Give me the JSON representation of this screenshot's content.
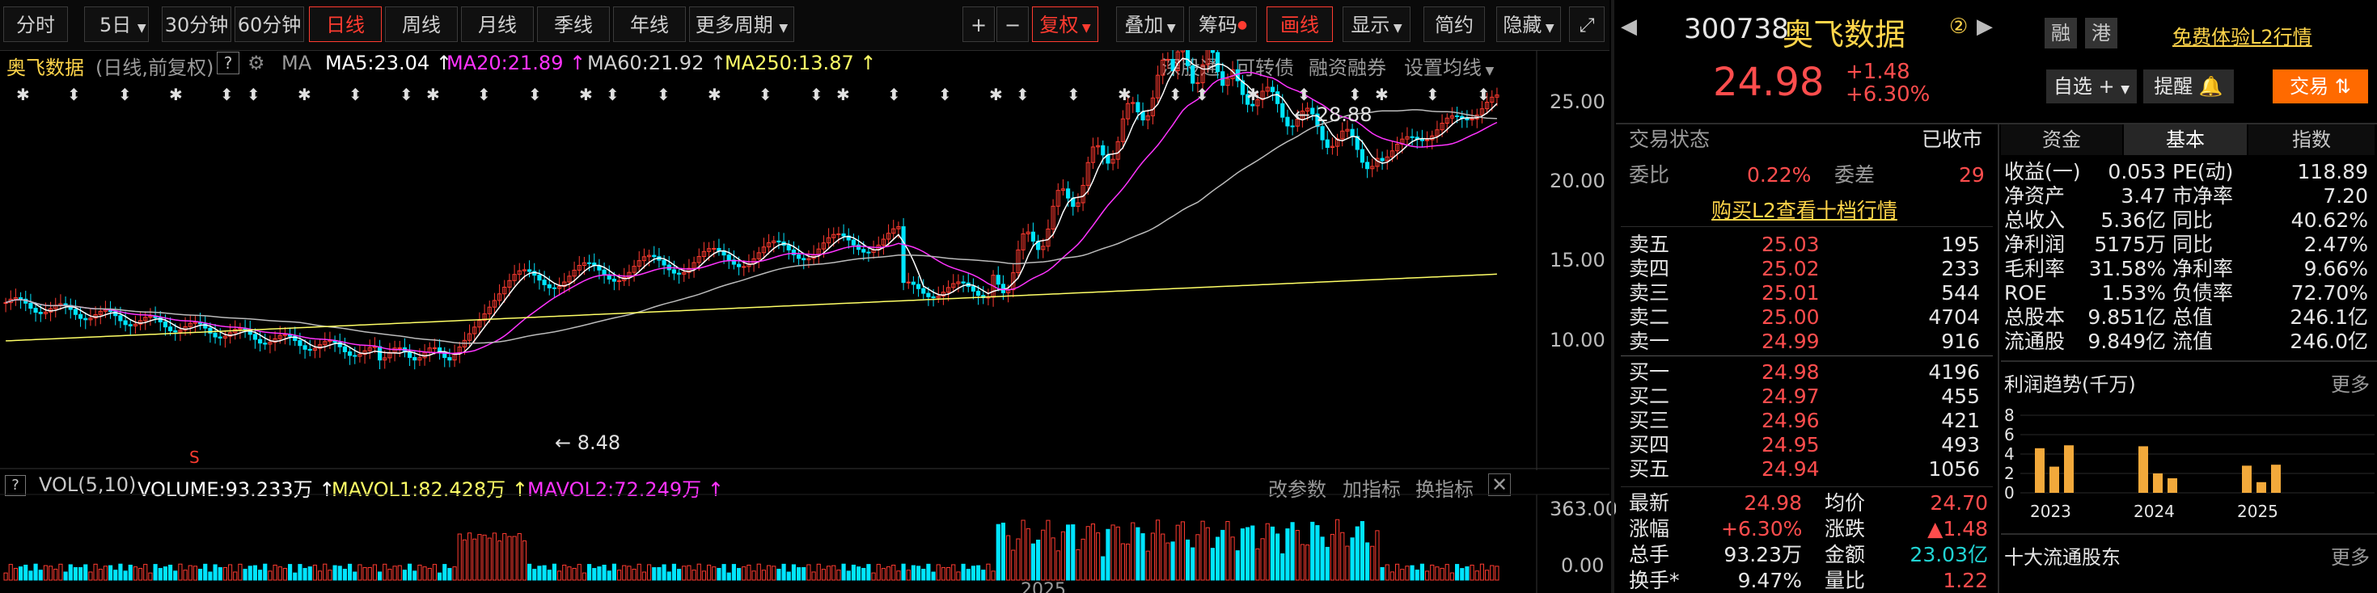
{
  "toolbar": {
    "tabs": [
      "分时",
      "5日",
      "30分钟",
      "60分钟",
      "日线",
      "周线",
      "月线",
      "季线",
      "年线",
      "更多周期"
    ],
    "active_tab": "日线",
    "plus": "+",
    "minus": "−",
    "fuquan": "复权",
    "diejia": "叠加",
    "chouma": "筹码",
    "huaxian": "画线",
    "xianshi": "显示",
    "jianyue": "简约",
    "yincang": "隐藏"
  },
  "legend": {
    "name": "奥飞数据",
    "note": "(日线,前复权)",
    "help": "?",
    "ma": "MA",
    "ma5": "MA5:23.04",
    "ma20": "MA20:21.89",
    "ma60": "MA60:21.92",
    "ma250": "MA250:13.87",
    "links": [
      "深股通",
      "可转债",
      "融资融券",
      "设置均线"
    ]
  },
  "price_axis": [
    "25.00",
    "20.00",
    "15.00",
    "10.00"
  ],
  "annotations": {
    "high": "28.88",
    "low": "8.48",
    "marker": "S"
  },
  "volume": {
    "help": "?",
    "label": "VOL(5,10)",
    "volume": "VOLUME:93.233万",
    "mavol1": "MAVOL1:82.428万",
    "mavol2": "MAVOL2:72.249万",
    "links": [
      "改参数",
      "加指标",
      "换指标"
    ],
    "axis_top": "363.00",
    "axis_bottom": "0.00"
  },
  "xaxis": {
    "year": "2025"
  },
  "quote": {
    "code": "300738",
    "name": "奥飞数据",
    "badge": "②",
    "tags": [
      "融",
      "港"
    ],
    "trial": "免费体验L2行情",
    "price": "24.98",
    "change": "+1.48",
    "change_pct": "+6.30%",
    "zixuan": "自选",
    "tixing": "提醒",
    "jiaoyi": "交易"
  },
  "status": {
    "label": "交易状态",
    "value": "已收市"
  },
  "weibi": {
    "label": "委比",
    "value": "0.22%",
    "cha_label": "委差",
    "cha_value": "29"
  },
  "l2_link": "购买L2查看十档行情",
  "asks": [
    {
      "label": "卖五",
      "price": "25.03",
      "vol": "195"
    },
    {
      "label": "卖四",
      "price": "25.02",
      "vol": "233"
    },
    {
      "label": "卖三",
      "price": "25.01",
      "vol": "544"
    },
    {
      "label": "卖二",
      "price": "25.00",
      "vol": "4704"
    },
    {
      "label": "卖一",
      "price": "24.99",
      "vol": "916"
    }
  ],
  "bids": [
    {
      "label": "买一",
      "price": "24.98",
      "vol": "4196"
    },
    {
      "label": "买二",
      "price": "24.97",
      "vol": "455"
    },
    {
      "label": "买三",
      "price": "24.96",
      "vol": "421"
    },
    {
      "label": "买四",
      "price": "24.95",
      "vol": "493"
    },
    {
      "label": "买五",
      "price": "24.94",
      "vol": "1056"
    }
  ],
  "summary": [
    {
      "l1": "最新",
      "v1": "24.98",
      "l2": "均价",
      "v2": "24.70"
    },
    {
      "l1": "涨幅",
      "v1": "+6.30%",
      "l2": "涨跌",
      "v2": "▲1.48"
    },
    {
      "l1": "总手",
      "v1": "93.23万",
      "l2": "金额",
      "v2": "23.03亿"
    },
    {
      "l1": "换手*",
      "v1": "9.47%",
      "l2": "量比",
      "v2": "1.22"
    }
  ],
  "tabs2": [
    "资金",
    "基本",
    "指数"
  ],
  "fundamentals": [
    {
      "l1": "收益(一)",
      "v1": "0.053",
      "l2": "PE(动)",
      "v2": "118.89"
    },
    {
      "l1": "净资产",
      "v1": "3.47",
      "l2": "市净率",
      "v2": "7.20"
    },
    {
      "l1": "总收入",
      "v1": "5.36亿",
      "l2": "同比",
      "v2": "40.62%"
    },
    {
      "l1": "净利润",
      "v1": "5175万",
      "l2": "同比",
      "v2": "2.47%"
    },
    {
      "l1": "毛利率",
      "v1": "31.58%",
      "l2": "净利率",
      "v2": "9.66%"
    },
    {
      "l1": "ROE",
      "v1": "1.53%",
      "l2": "负债率",
      "v2": "72.70%"
    },
    {
      "l1": "总股本",
      "v1": "9.851亿",
      "l2": "总值",
      "v2": "246.1亿"
    },
    {
      "l1": "流通股",
      "v1": "9.849亿",
      "l2": "流值",
      "v2": "246.0亿"
    }
  ],
  "profit": {
    "title": "利润趋势(千万)",
    "more": "更多",
    "yticks": [
      "8",
      "6",
      "4",
      "2",
      "0"
    ],
    "years": [
      "2023",
      "2024",
      "2025"
    ],
    "values": [
      4.6,
      2.7,
      4.9,
      4.8,
      2.0,
      1.5,
      2.8,
      1.1,
      2.9
    ]
  },
  "holders": {
    "title": "十大流通股东",
    "more": "更多"
  },
  "colors": {
    "up": "#ff3b30",
    "down": "#00e5ff",
    "ma5": "#ffffff",
    "ma20": "#ff33ff",
    "ma60": "#bbbbbb",
    "ma250": "#ffff66",
    "accent": "#ff6a00"
  }
}
